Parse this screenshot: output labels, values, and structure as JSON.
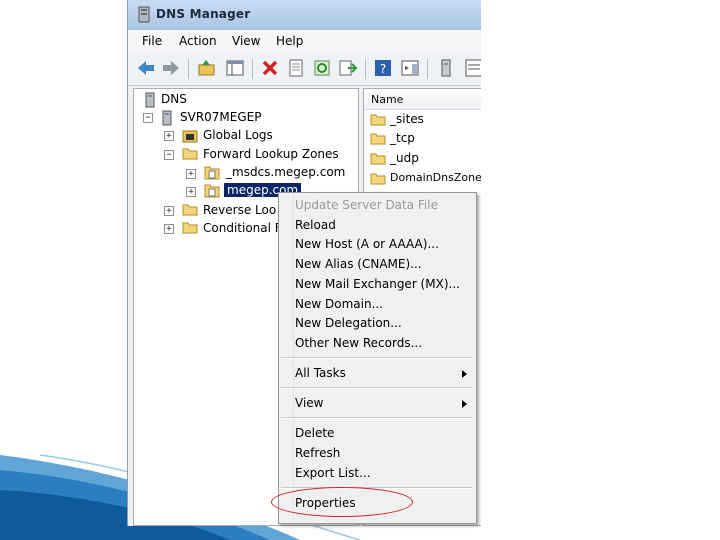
{
  "window": {
    "title": "DNS Manager"
  },
  "menubar": [
    "File",
    "Action",
    "View",
    "Help"
  ],
  "tree": {
    "root": "DNS",
    "server": "SVR07MEGEP",
    "nodes": [
      "Global Logs",
      "Forward Lookup Zones",
      "_msdcs.megep.com",
      "megep.com",
      "Reverse Loo",
      "Conditional F"
    ]
  },
  "list": {
    "header": "Name",
    "items": [
      "_sites",
      "_tcp",
      "_udp",
      "DomainDnsZones"
    ]
  },
  "context_menu": {
    "items": [
      "Update Server Data File",
      "Reload",
      "New Host (A or AAAA)...",
      "New Alias (CNAME)...",
      "New Mail Exchanger (MX)...",
      "New Domain...",
      "New Delegation...",
      "Other New Records...",
      "All Tasks",
      "View",
      "Delete",
      "Refresh",
      "Export List...",
      "Properties"
    ]
  },
  "colors": {
    "highlight": "#d12424",
    "selection": "#0a246a",
    "slide_accent": "#1f6fb5"
  }
}
